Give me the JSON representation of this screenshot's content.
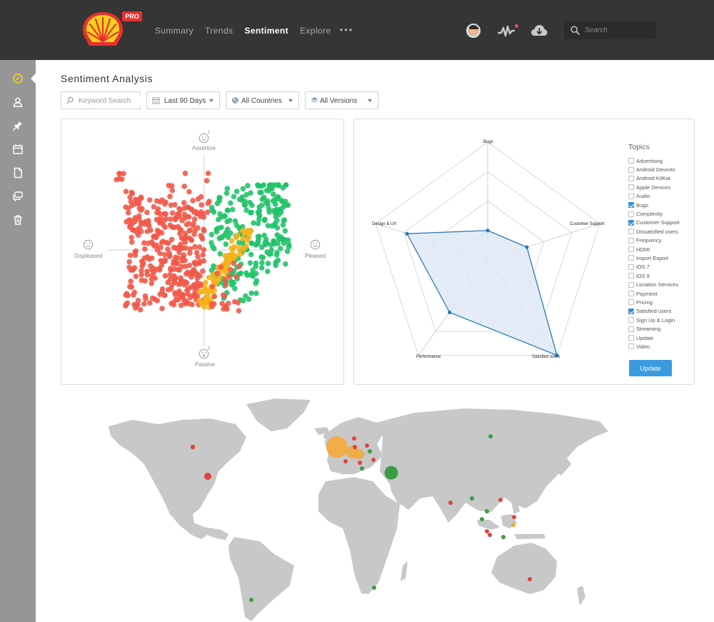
{
  "header": {
    "brand_badge": "PRO",
    "nav": [
      {
        "label": "Summary",
        "active": false
      },
      {
        "label": "Trends",
        "active": false
      },
      {
        "label": "Sentiment",
        "active": true
      },
      {
        "label": "Explore",
        "active": false
      }
    ],
    "more_label": "•••",
    "search_placeholder": "Search",
    "icons": [
      "user-avatar",
      "pulse-icon",
      "cloud-icon",
      "search-icon"
    ]
  },
  "sidebar": {
    "items": [
      "compass-icon",
      "user-icon",
      "pin-icon",
      "calendar-icon",
      "document-icon",
      "chat-icon",
      "trash-icon"
    ],
    "active_index": 0
  },
  "page": {
    "title": "Sentiment Analysis"
  },
  "filters": {
    "keyword_placeholder": "Keyword Search",
    "date_range": "Last 90 Days",
    "country": "All Countries",
    "version": "All Versions"
  },
  "scatter": {
    "axis_top": "Assertive",
    "axis_bottom": "Passive",
    "axis_left": "Displeased",
    "axis_right": "Pleased",
    "top_superscript": "1",
    "bottom_superscript": "2",
    "colors": {
      "negative": "#f15a4a",
      "neutral": "#f7b21b",
      "positive": "#21c26a"
    }
  },
  "radar": {
    "axes": [
      "Bugs",
      "Customer Support",
      "Satisfied users",
      "Performance",
      "Design & UX"
    ],
    "values": [
      0.25,
      0.35,
      1.0,
      0.55,
      0.72
    ],
    "fill": "#dde9f5",
    "stroke": "#2a7ab8"
  },
  "topics": {
    "title": "Topics",
    "items": [
      {
        "label": "Advertising",
        "checked": false
      },
      {
        "label": "Android Devices",
        "checked": false
      },
      {
        "label": "Android KitKat",
        "checked": false
      },
      {
        "label": "Apple Devices",
        "checked": false
      },
      {
        "label": "Audio",
        "checked": false
      },
      {
        "label": "Bugs",
        "checked": true
      },
      {
        "label": "Complexity",
        "checked": false
      },
      {
        "label": "Customer Support",
        "checked": true
      },
      {
        "label": "Dissatisfied users",
        "checked": false
      },
      {
        "label": "Frequency",
        "checked": false
      },
      {
        "label": "HDMI",
        "checked": false
      },
      {
        "label": "Import Export",
        "checked": false
      },
      {
        "label": "iOS 7",
        "checked": false
      },
      {
        "label": "iOS 9",
        "checked": false
      },
      {
        "label": "Location Services",
        "checked": false
      },
      {
        "label": "Payment",
        "checked": false
      },
      {
        "label": "Pricing",
        "checked": false
      },
      {
        "label": "Satisfied users",
        "checked": true
      },
      {
        "label": "Sign Up & Login",
        "checked": false
      },
      {
        "label": "Streaming",
        "checked": false
      },
      {
        "label": "Update",
        "checked": false
      },
      {
        "label": "Video",
        "checked": false
      }
    ],
    "update_label": "Update"
  },
  "map": {
    "land_color": "#c8c8c8",
    "marker_colors": {
      "red": "#e2413e",
      "orange": "#f6a83a",
      "green": "#3b9b45"
    }
  }
}
